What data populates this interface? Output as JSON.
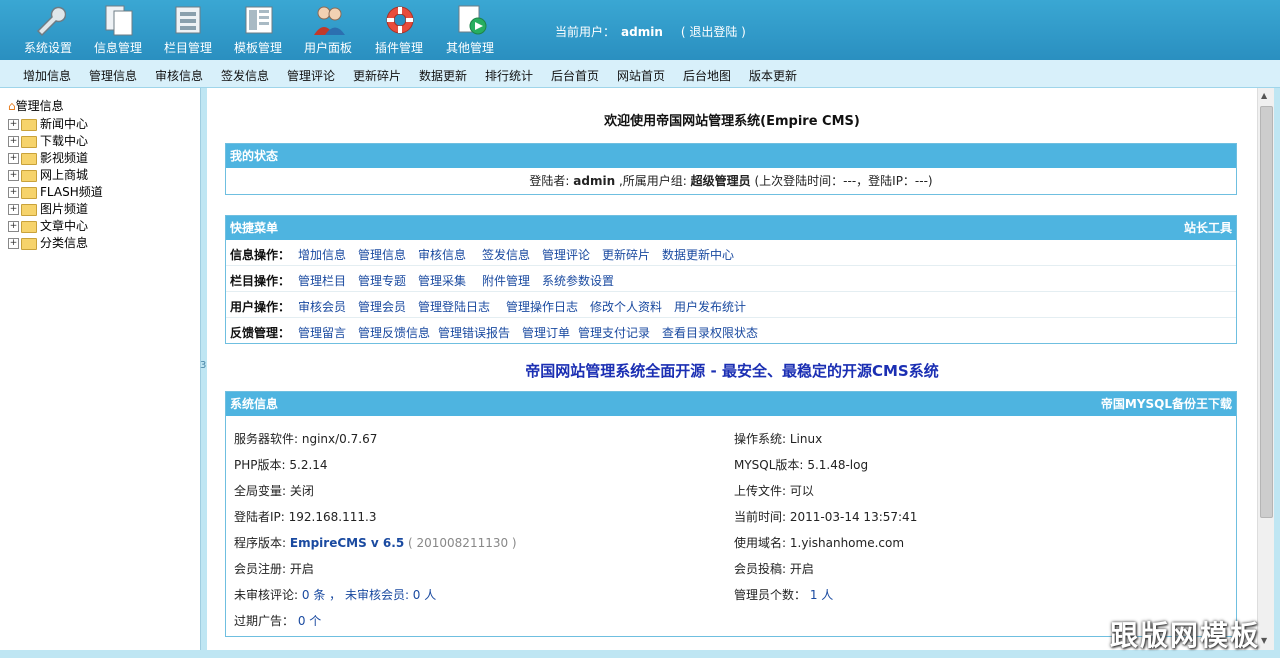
{
  "nav": [
    {
      "label": "系统设置",
      "icon": "wrench-icon"
    },
    {
      "label": "信息管理",
      "icon": "documents-icon"
    },
    {
      "label": "栏目管理",
      "icon": "columns-icon"
    },
    {
      "label": "模板管理",
      "icon": "template-icon"
    },
    {
      "label": "用户面板",
      "icon": "users-icon"
    },
    {
      "label": "插件管理",
      "icon": "lifebuoy-icon"
    },
    {
      "label": "其他管理",
      "icon": "play-document-icon"
    }
  ],
  "user": {
    "prefix": "当前用户：",
    "name": "admin",
    "logout": "( 退出登陆 )"
  },
  "submenu": [
    "增加信息",
    "管理信息",
    "审核信息",
    "签发信息",
    "管理评论",
    "更新碎片",
    "数据更新",
    "排行统计",
    "后台首页",
    "网站首页",
    "后台地图",
    "版本更新"
  ],
  "tree": {
    "root": "管理信息",
    "nodes": [
      "新闻中心",
      "下载中心",
      "影视频道",
      "网上商城",
      "FLASH频道",
      "图片频道",
      "文章中心",
      "分类信息"
    ]
  },
  "splitter": "3",
  "welcome": "欢迎使用帝国网站管理系统(Empire CMS)",
  "status": {
    "title": "我的状态",
    "login_label": "登陆者:",
    "login_user": "admin",
    "group_label": ",所属用户组:",
    "group": "超级管理员",
    "last": "(上次登陆时间：---，登陆IP：---)"
  },
  "quick": {
    "title": "快捷菜单",
    "right": "站长工具",
    "rows": [
      {
        "key": "信息操作：",
        "items": [
          "增加信息",
          "管理信息",
          "审核信息",
          "签发信息",
          "管理评论",
          "更新碎片",
          "数据更新中心"
        ]
      },
      {
        "key": "栏目操作：",
        "items": [
          "管理栏目",
          "管理专题",
          "管理采集",
          "附件管理",
          "系统参数设置"
        ]
      },
      {
        "key": "用户操作：",
        "items": [
          "审核会员",
          "管理会员",
          "管理登陆日志",
          "管理操作日志",
          "修改个人资料",
          "用户发布统计"
        ]
      },
      {
        "key": "反馈管理：",
        "items": [
          "管理留言",
          "管理反馈信息",
          "管理错误报告",
          "管理订单",
          "管理支付记录",
          "查看目录权限状态"
        ]
      }
    ]
  },
  "slogan": "帝国网站管理系统全面开源 - 最安全、最稳定的开源CMS系统",
  "sys": {
    "title": "系统信息",
    "right": "帝国MYSQL备份王下载",
    "left": [
      {
        "label": "服务器软件:",
        "value": "nginx/0.7.67"
      },
      {
        "label": "PHP版本:",
        "value": "5.2.14"
      },
      {
        "label": "全局变量:",
        "value": "关闭"
      },
      {
        "label": "登陆者IP:",
        "value": "192.168.111.3"
      },
      {
        "label": "程序版本:",
        "value": "EmpireCMS v 6.5",
        "extra": "( 201008211130 )"
      },
      {
        "label": "会员注册:",
        "value": "开启"
      },
      {
        "label": "未审核评论:",
        "value": "0 条 ， 未审核会员: 0 人"
      },
      {
        "label": "过期广告：",
        "value": "0 个"
      }
    ],
    "right_col": [
      {
        "label": "操作系统:",
        "value": "Linux"
      },
      {
        "label": "MYSQL版本:",
        "value": "5.1.48-log"
      },
      {
        "label": "上传文件:",
        "value": "可以"
      },
      {
        "label": "当前时间:",
        "value": "2011-03-14 13:57:41"
      },
      {
        "label": "使用域名:",
        "value": "1.yishanhome.com"
      },
      {
        "label": "会员投稿:",
        "value": "开启"
      },
      {
        "label": "管理员个数：",
        "value": "1 人"
      }
    ]
  },
  "watermark": "跟版网模板"
}
